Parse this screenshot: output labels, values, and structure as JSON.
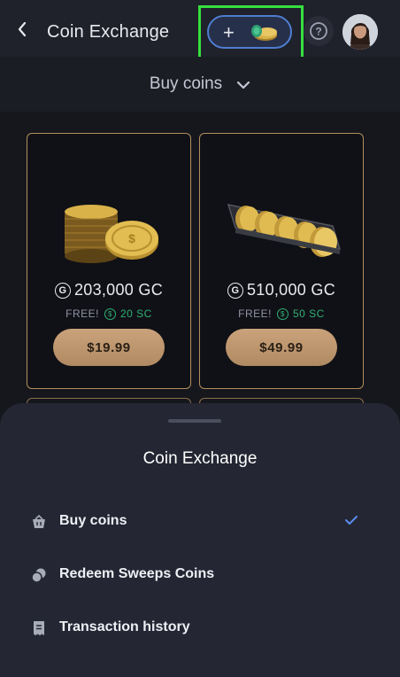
{
  "header": {
    "title": "Coin Exchange",
    "add_coins_plus": "+",
    "help_label": "?"
  },
  "selector": {
    "label": "Buy coins"
  },
  "packages": [
    {
      "amount": "203,000 GC",
      "free_label": "FREE!",
      "bonus": "20 SC",
      "price": "$19.99"
    },
    {
      "amount": "510,000 GC",
      "free_label": "FREE!",
      "bonus": "50 SC",
      "price": "$49.99"
    }
  ],
  "sheet": {
    "title": "Coin Exchange",
    "items": [
      {
        "label": "Buy coins",
        "icon": "basket-icon",
        "selected": true
      },
      {
        "label": "Redeem Sweeps Coins",
        "icon": "coins-icon",
        "selected": false
      },
      {
        "label": "Transaction history",
        "icon": "receipt-icon",
        "selected": false
      }
    ]
  },
  "colors": {
    "accent_gold": "#caa27b",
    "sweeps_green": "#2fb176",
    "highlight_green": "#36e03f",
    "check_blue": "#5b8cf0"
  }
}
